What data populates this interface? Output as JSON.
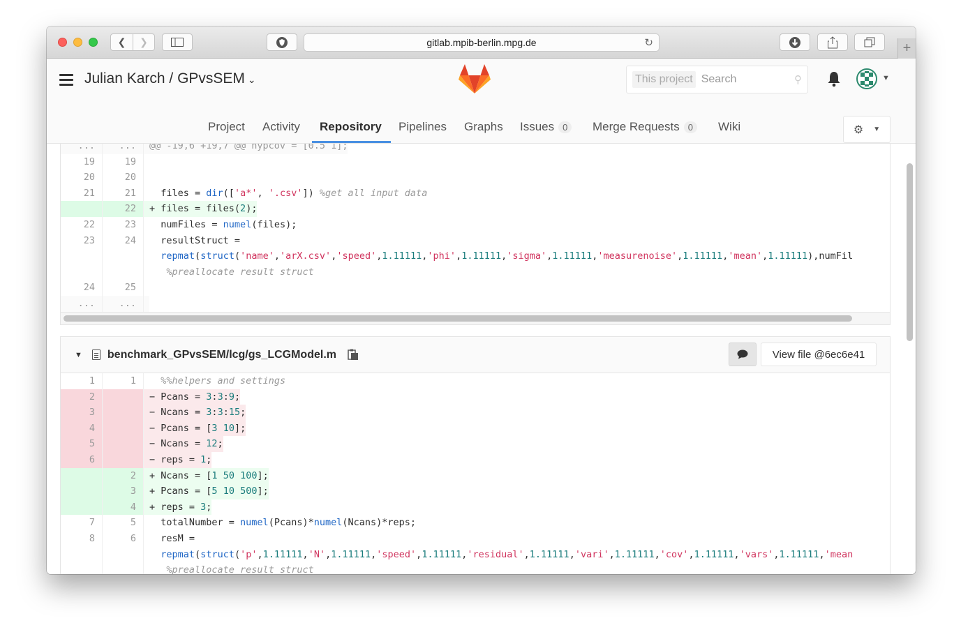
{
  "browser": {
    "url": "gitlab.mpib-berlin.mpg.de"
  },
  "header": {
    "project_title": "Julian Karch / GPvsSEM",
    "search_scope": "This project",
    "search_placeholder": "Search"
  },
  "nav": {
    "items": [
      {
        "label": "Project"
      },
      {
        "label": "Activity"
      },
      {
        "label": "Repository",
        "active": true
      },
      {
        "label": "Pipelines"
      },
      {
        "label": "Graphs"
      },
      {
        "label": "Issues",
        "count": "0"
      },
      {
        "label": "Merge Requests",
        "count": "0"
      },
      {
        "label": "Wiki"
      }
    ]
  },
  "diff1": {
    "hunk_header": "@@ -19,6 +19,7 @@ hypcov = [0.5 1];",
    "rows": [
      {
        "old": "19",
        "new": "19",
        "type": "ctx",
        "code": ""
      },
      {
        "old": "20",
        "new": "20",
        "type": "ctx",
        "code": ""
      },
      {
        "old": "21",
        "new": "21",
        "type": "ctx",
        "code": "files = dir(['a*', '.csv']) %get all input data"
      },
      {
        "old": "",
        "new": "22",
        "type": "add",
        "code": "files = files(2);"
      },
      {
        "old": "22",
        "new": "23",
        "type": "ctx",
        "code": "numFiles = numel(files);"
      },
      {
        "old": "23",
        "new": "24",
        "type": "ctx",
        "code": "resultStruct ="
      },
      {
        "old": "",
        "new": "",
        "type": "ctx",
        "code": "repmat(struct('name','arX.csv','speed',1.11111,'phi',1.11111,'sigma',1.11111,'measurenoise',1.11111,'mean',1.11111),numFil"
      },
      {
        "old": "",
        "new": "",
        "type": "ctx",
        "code": " %preallocate result struct"
      },
      {
        "old": "24",
        "new": "25",
        "type": "ctx",
        "code": ""
      },
      {
        "old": "...",
        "new": "...",
        "type": "match",
        "code": ""
      }
    ]
  },
  "diff2": {
    "file_path": "benchmark_GPvsSEM/lcg/gs_LCGModel.m",
    "view_file_label": "View file @6ec6e41",
    "rows": [
      {
        "old": "1",
        "new": "1",
        "type": "ctx",
        "code": "%%helpers and settings"
      },
      {
        "old": "2",
        "new": "",
        "type": "del",
        "code": "Pcans = 3:3:9;"
      },
      {
        "old": "3",
        "new": "",
        "type": "del",
        "code": "Ncans = 3:3:15;"
      },
      {
        "old": "4",
        "new": "",
        "type": "del",
        "code": "Pcans = [3 10];"
      },
      {
        "old": "5",
        "new": "",
        "type": "del",
        "code": "Ncans = 12;"
      },
      {
        "old": "6",
        "new": "",
        "type": "del",
        "code": "reps = 1;"
      },
      {
        "old": "",
        "new": "2",
        "type": "add",
        "code": "Ncans = [1 50 100];"
      },
      {
        "old": "",
        "new": "3",
        "type": "add",
        "code": "Pcans = [5 10 500];"
      },
      {
        "old": "",
        "new": "4",
        "type": "add",
        "code": "reps = 3;"
      },
      {
        "old": "7",
        "new": "5",
        "type": "ctx",
        "code": "totalNumber = numel(Pcans)*numel(Ncans)*reps;"
      },
      {
        "old": "8",
        "new": "6",
        "type": "ctx",
        "code": "resM ="
      },
      {
        "old": "",
        "new": "",
        "type": "ctx",
        "code": "repmat(struct('p',1.11111,'N',1.11111,'speed',1.11111,'residual',1.11111,'vari',1.11111,'cov',1.11111,'vars',1.11111,'mean"
      },
      {
        "old": "",
        "new": "",
        "type": "ctx",
        "code": " %preallocate result struct"
      }
    ]
  },
  "colors": {
    "add_bg": "#ecfdf0",
    "del_bg": "#fbe9eb",
    "active_tab": "#4a90e2",
    "logo": "#fc6d26"
  }
}
